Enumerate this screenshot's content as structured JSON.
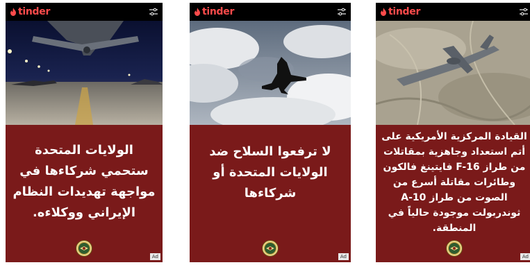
{
  "cards": [
    {
      "brand": "tinder",
      "ad_badge": "Ad",
      "text": "الولايات المتحدة ستحمي شركاءها في مواجهة تهديدات النظام الإيراني ووكلاءه."
    },
    {
      "brand": "tinder",
      "ad_badge": "Ad",
      "text": "لا ترفعوا السلاح ضد الولايات المتحدة أو شركاءها"
    },
    {
      "brand": "tinder",
      "ad_badge": "Ad",
      "text": "القيادة المركزية الأمريكية على أتم استعداد وجاهزية بمقاتلات من طراز F-16 فايتينغ فالكون وطائرات مقاتلة أسرع من الصوت من طراز A-10 ثوندربولت موجودة حالياً في المنطقة."
    }
  ],
  "colors": {
    "brand": "#ff4b4b",
    "card_bg": "#7a1a1a",
    "topbar": "#000000"
  },
  "icons": [
    "tinder-flame-icon",
    "filter-icon",
    "centcom-seal-icon"
  ]
}
